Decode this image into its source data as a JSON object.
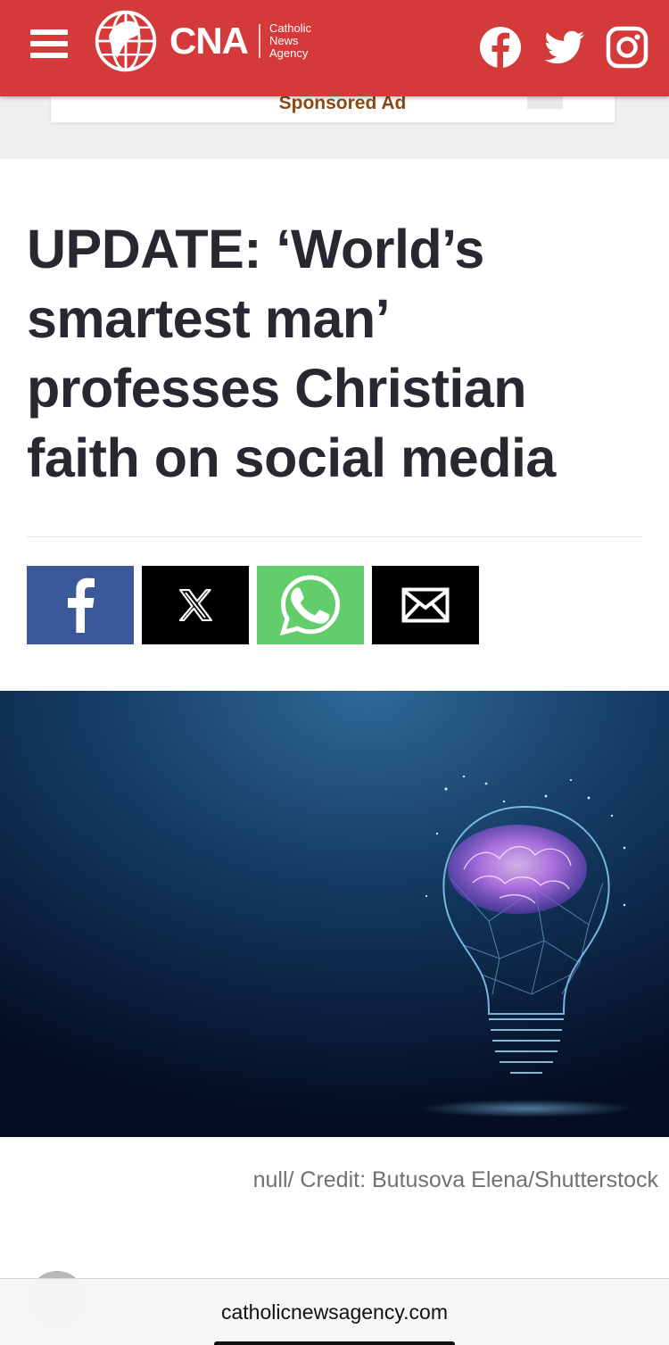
{
  "header": {
    "logo_text": "CNA",
    "logo_subtitle": [
      "Catholic",
      "News",
      "Agency"
    ],
    "background_color": "#d43a3a",
    "icons": [
      "hamburger-menu-icon",
      "facebook-icon",
      "twitter-icon",
      "instagram-icon"
    ]
  },
  "ad": {
    "label": "Sponsored Ad"
  },
  "article": {
    "headline": "UPDATE: ‘World’s smartest man’ professes Christian faith on social media",
    "share_buttons": [
      {
        "name": "facebook",
        "color": "#3b5998"
      },
      {
        "name": "x",
        "color": "#000000"
      },
      {
        "name": "whatsapp",
        "color": "#62cd6b"
      },
      {
        "name": "email",
        "color": "#000000"
      }
    ],
    "image_caption": "null/ Credit: Butusova Elena/Shutterstock"
  },
  "browser": {
    "url": "catholicnewsagency.com"
  }
}
